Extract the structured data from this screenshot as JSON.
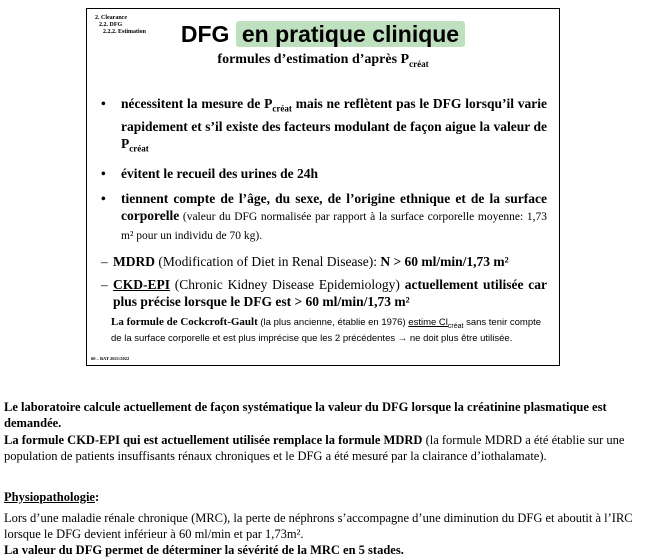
{
  "slide": {
    "breadcrumb": [
      "2. Clearance",
      "2.2. DFG",
      "2.2.2. Estimation"
    ],
    "title_pre": "DFG ",
    "title_hl": "en pratique clinique",
    "subtitle": "formules d’estimation d’après P",
    "subtitle_sub": "créat",
    "bullets": [
      {
        "a": "nécessitent la mesure de P",
        "sub": "créat",
        "b": " mais ne reflètent pas le DFG lorsqu’il varie rapidement et s’il existe des facteurs modulant de façon aigue la valeur de P",
        "sub2": "créat"
      },
      {
        "a": "évitent le recueil des urines de 24h"
      },
      {
        "a": "tiennent compte de l’âge, du sexe, de l’origine ethnique et de la surface corporelle",
        "norm": " (valeur du DFG normalisée par rapport à la surface corporelle moyenne: 1,73 m² pour un individu de 70 kg)."
      }
    ],
    "mdrd": {
      "name": "MDRD",
      "desc": " (Modification of Diet in Renal Disease): ",
      "value": "N > 60 ml/min/1,73 m²"
    },
    "ckd": {
      "name": "CKD-EPI",
      "desc": " (Chronic Kidney Disease Epidemiology) ",
      "value": "actuellement utilisée car plus précise lorsque le DFG est > 60 ml/min/1,73 m²"
    },
    "note": {
      "bold": "La formule de Cockcroft-Gault",
      "a": " (la plus ancienne, établie en 1976) ",
      "u": "estime Cl",
      "sub": "créat",
      "b": " sans tenir compte de la surface corporelle et est plus imprécise que les 2 précédentes → ne doit plus être utilisée."
    },
    "footer": "60 – BAT 2021/2022"
  },
  "body": {
    "p1": "Le laboratoire calcule actuellement de façon systématique la valeur du DFG lorsque la créatinine plasmatique est demandée.",
    "p2_bold": "La formule CKD-EPI qui est actuellement utilisée remplace la formule MDRD",
    "p2_rest": " (la formule MDRD a été établie sur une population de patients insuffisants rénaux chroniques et le DFG a été mesuré par la clairance d’iothalamate).",
    "physio_heading": "Physiopathologie",
    "physio_colon": ":",
    "p3": "Lors d’une maladie rénale chronique (MRC), la perte de néphrons s’accompagne d’une diminution du DFG et aboutit à l’IRC lorsque le DFG devient inférieur à 60 ml/min et par 1,73m².",
    "p4": "La valeur du DFG permet de déterminer la sévérité de la MRC en 5 stades."
  }
}
